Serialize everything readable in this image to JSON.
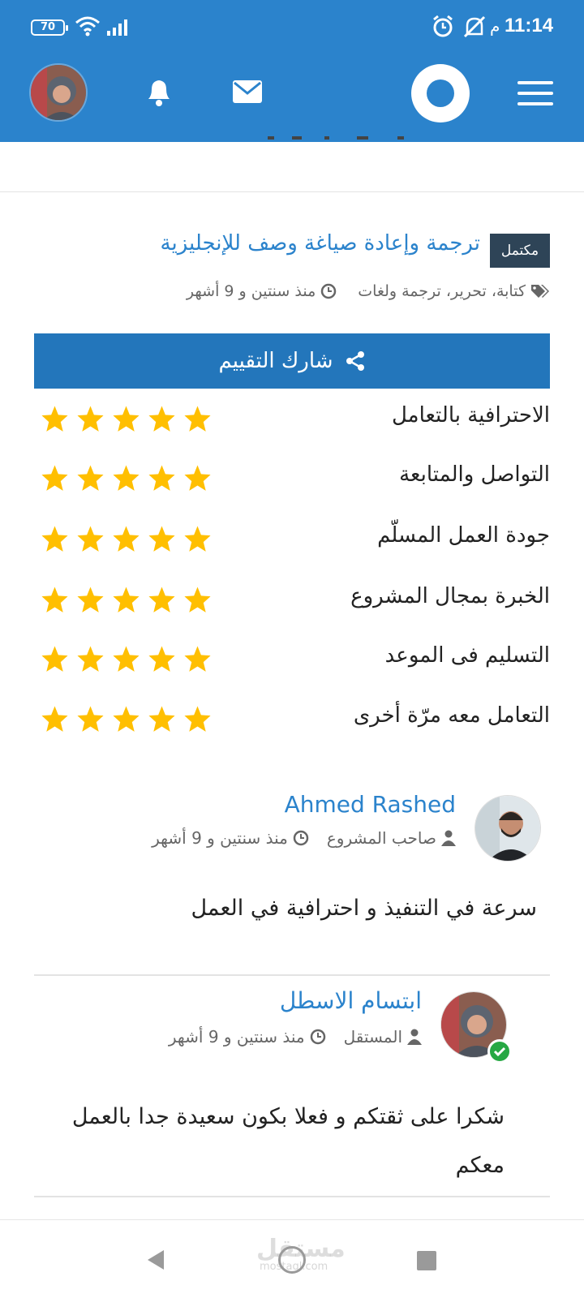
{
  "status": {
    "battery": "70",
    "time": "11:14",
    "ampm": "م"
  },
  "header": {
    "icons": [
      "avatar",
      "bell-icon",
      "mail-icon",
      "mostaql-logo",
      "menu-icon"
    ]
  },
  "project": {
    "badge": "مكتمل",
    "title": "ترجمة وإعادة صياغة وصف للإنجليزية",
    "tags": "كتابة، تحرير، ترجمة ولغات",
    "time": "منذ سنتين و 9 أشهر"
  },
  "share_label": "شارك التقييم",
  "ratings": [
    {
      "label": "الاحترافية بالتعامل",
      "stars": 5
    },
    {
      "label": "التواصل والمتابعة",
      "stars": 5
    },
    {
      "label": "جودة العمل المسلّم",
      "stars": 5
    },
    {
      "label": "الخبرة بمجال المشروع",
      "stars": 5
    },
    {
      "label": "التسليم فى الموعد",
      "stars": 5
    },
    {
      "label": "التعامل معه مرّة أخرى",
      "stars": 5
    }
  ],
  "comments": [
    {
      "name": "Ahmed Rashed",
      "role": "صاحب المشروع",
      "time": "منذ سنتين و 9 أشهر",
      "text": "سرعة في التنفيذ و احترافية في العمل"
    },
    {
      "name": "ابتسام الاسطل",
      "role": "المستقل",
      "time": "منذ سنتين و 9 أشهر",
      "text": "شكرا على ثقتكم و فعلا بكون سعيدة جدا بالعمل معكم"
    }
  ],
  "watermark": {
    "brand": "مستقل",
    "domain": "mostaql.com"
  },
  "colors": {
    "primary": "#2b83cc",
    "badge": "#2e4457",
    "star": "#ffbf00"
  }
}
